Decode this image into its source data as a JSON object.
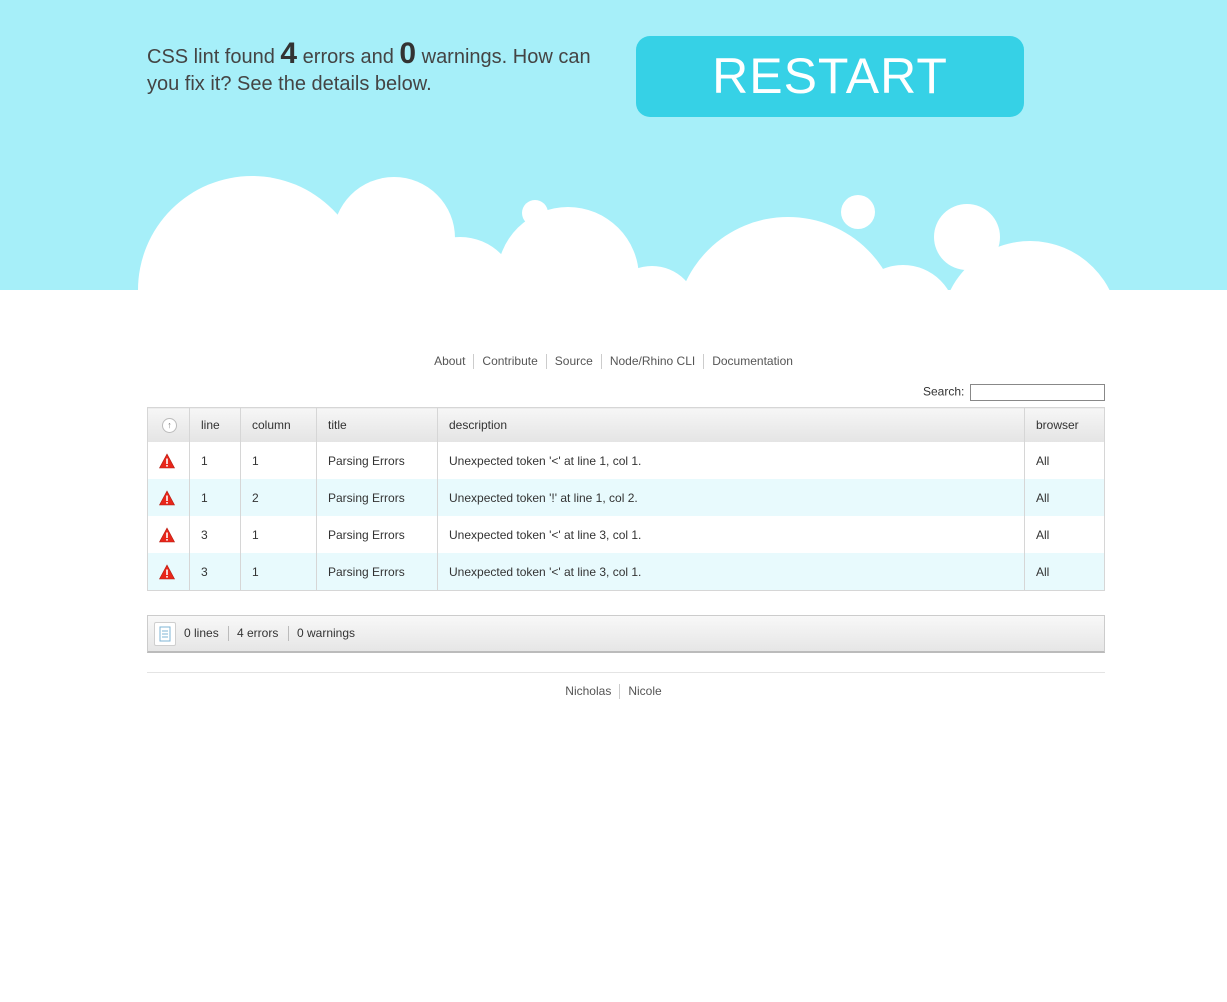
{
  "summary": {
    "prefix": "CSS lint found ",
    "errors": "4",
    "middle": " errors and ",
    "warnings": "0",
    "suffix": " warnings. How can you fix it? See the details below."
  },
  "restart_label": "RESTART",
  "nav": [
    "About",
    "Contribute",
    "Source",
    "Node/Rhino CLI",
    "Documentation"
  ],
  "search": {
    "label": "Search:",
    "value": ""
  },
  "table": {
    "headers": [
      "line",
      "column",
      "title",
      "description",
      "browser"
    ],
    "rows": [
      {
        "icon": "warning-icon",
        "line": "1",
        "column": "1",
        "title": "Parsing Errors",
        "description": "Unexpected token '<' at line 1, col 1.",
        "browser": "All"
      },
      {
        "icon": "warning-icon",
        "line": "1",
        "column": "2",
        "title": "Parsing Errors",
        "description": "Unexpected token '!' at line 1, col 2.",
        "browser": "All"
      },
      {
        "icon": "warning-icon",
        "line": "3",
        "column": "1",
        "title": "Parsing Errors",
        "description": "Unexpected token '<' at line 3, col 1.",
        "browser": "All"
      },
      {
        "icon": "warning-icon",
        "line": "3",
        "column": "1",
        "title": "Parsing Errors",
        "description": "Unexpected token '<' at line 3, col 1.",
        "browser": "All"
      }
    ]
  },
  "status": {
    "lines": "0 lines",
    "errors": "4 errors",
    "warnings": "0 warnings"
  },
  "footer": [
    "Nicholas",
    "Nicole"
  ],
  "colors": {
    "sky": "#a6eff9",
    "button": "#36d1e6",
    "row_alt": "#e8fafd",
    "warning": "#e8261a"
  }
}
